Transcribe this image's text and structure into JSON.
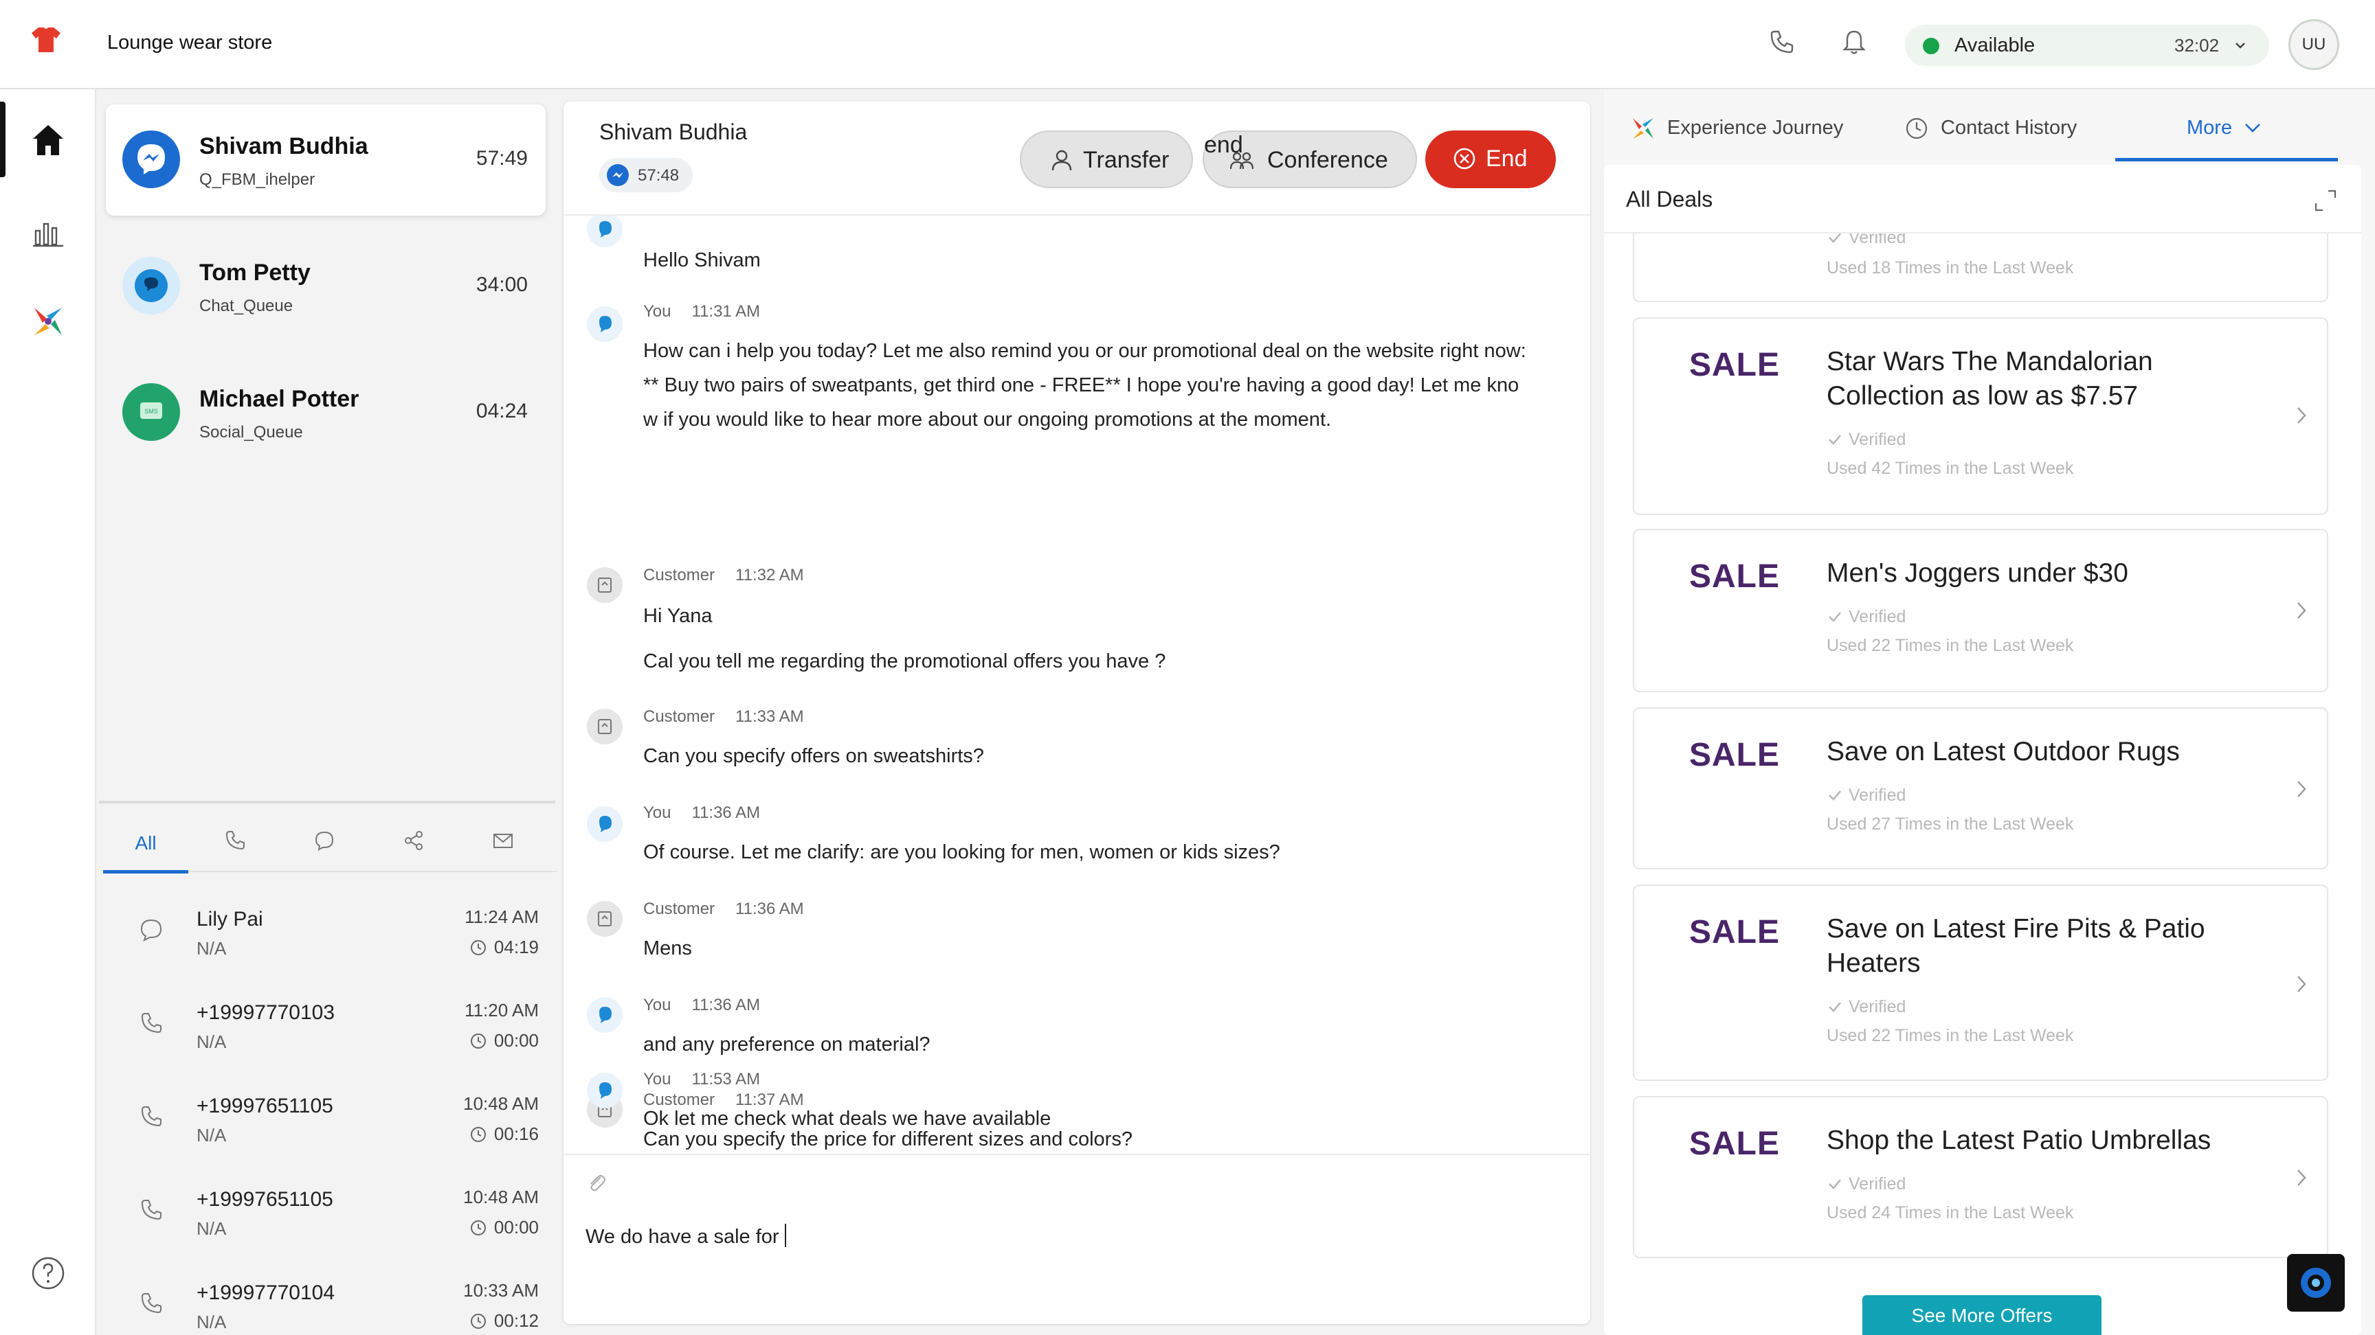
{
  "app": {
    "store_name": "Lounge wear store",
    "status": "Available",
    "status_timer": "32:02",
    "avatar_initials": "UU"
  },
  "colors": {
    "accent": "#1c6bd0",
    "end": "#d92d20",
    "available": "#16a34a",
    "sale": "#4a2569",
    "cta": "#11a3b5"
  },
  "queue": {
    "conversations": [
      {
        "name": "Shivam Budhia",
        "queue": "Q_FBM_ihelper",
        "time": "57:49",
        "icon": "messenger-icon"
      },
      {
        "name": "Tom Petty",
        "queue": "Chat_Queue",
        "time": "34:00",
        "icon": "chat-icon"
      },
      {
        "name": "Michael Potter",
        "queue": "Social_Queue",
        "time": "04:24",
        "icon": "sms-icon"
      }
    ],
    "filter_all": "All",
    "history": [
      {
        "name": "Lily Pai",
        "sub": "N/A",
        "time": "11:24 AM",
        "duration": "04:19",
        "icon": "chat-icon"
      },
      {
        "name": "+19997770103",
        "sub": "N/A",
        "time": "11:20 AM",
        "duration": "00:00",
        "icon": "phone-icon"
      },
      {
        "name": "+19997651105",
        "sub": "N/A",
        "time": "10:48 AM",
        "duration": "00:16",
        "icon": "phone-icon"
      },
      {
        "name": "+19997651105",
        "sub": "N/A",
        "time": "10:48 AM",
        "duration": "00:00",
        "icon": "phone-icon"
      },
      {
        "name": "+19997770104",
        "sub": "N/A",
        "time": "10:33 AM",
        "duration": "00:12",
        "icon": "phone-icon"
      }
    ]
  },
  "chat": {
    "contact": "Shivam Budhia",
    "timer": "57:48",
    "transfer_label": "Transfer",
    "conference_label": "Conference",
    "end_label": "End",
    "messages": [
      {
        "sender": "",
        "time": "",
        "lines": [
          "Hello Shivam"
        ]
      },
      {
        "sender": "You",
        "time": "11:31 AM",
        "lines": [
          "How can i help you today? Let me also remind you or our promotional deal on the website right now:",
          "** Buy two pairs of sweatpants, get third one - FREE** I hope you're having a good day! Let me kno",
          "w if you would like to hear more about our ongoing promotions at the moment."
        ]
      },
      {
        "sender": "Customer",
        "time": "11:32 AM",
        "lines": [
          "Hi Yana"
        ]
      },
      {
        "sender": "",
        "time": "",
        "lines": [
          "Cal you tell me regarding the promotional offers you have ?"
        ]
      },
      {
        "sender": "Customer",
        "time": "11:33 AM",
        "lines": [
          "Can you specify offers on sweatshirts?"
        ]
      },
      {
        "sender": "You",
        "time": "11:36 AM",
        "lines": [
          "Of course. Let me clarify: are you looking for men, women or kids sizes?"
        ]
      },
      {
        "sender": "Customer",
        "time": "11:36 AM",
        "lines": [
          "Mens"
        ]
      },
      {
        "sender": "You",
        "time": "11:36 AM",
        "lines": [
          "and any preference on material?"
        ]
      },
      {
        "sender": "Customer",
        "time": "11:37 AM",
        "lines": [
          "Can you specify the price for different sizes and colors?"
        ]
      },
      {
        "sender": "You",
        "time": "11:53 AM",
        "lines": [
          "Ok let me check what deals we have available"
        ]
      }
    ],
    "composer_text": "We do have a sale for"
  },
  "right": {
    "tabs": {
      "journey": "Experience Journey",
      "history": "Contact History",
      "more": "More"
    },
    "deals_title": "All Deals",
    "deals": [
      {
        "badge": "",
        "title": "",
        "verified": "Verified",
        "used": "Used 18 Times in the Last Week"
      },
      {
        "badge": "SALE",
        "title": "Star Wars The Mandalorian Collection as low as $7.57",
        "verified": "Verified",
        "used": "Used 42 Times in the Last Week"
      },
      {
        "badge": "SALE",
        "title": "Men's Joggers under $30",
        "verified": "Verified",
        "used": "Used 22 Times in the Last Week"
      },
      {
        "badge": "SALE",
        "title": "Save on Latest Outdoor Rugs",
        "verified": "Verified",
        "used": "Used 27 Times in the Last Week"
      },
      {
        "badge": "SALE",
        "title": "Save on Latest Fire Pits & Patio Heaters",
        "verified": "Verified",
        "used": "Used 22 Times in the Last Week"
      },
      {
        "badge": "SALE",
        "title": "Shop the Latest Patio Umbrellas",
        "verified": "Verified",
        "used": "Used 24 Times in the Last Week"
      }
    ],
    "see_more": "See More Offers"
  }
}
